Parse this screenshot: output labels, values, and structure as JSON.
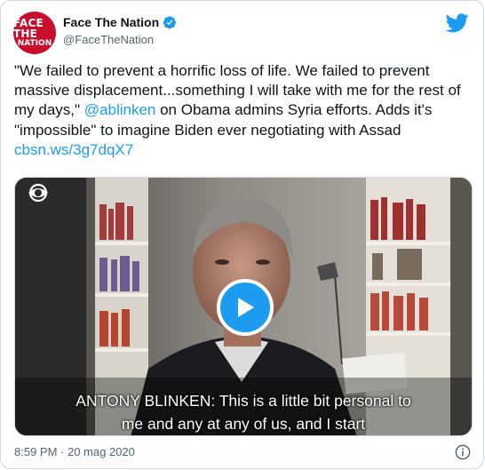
{
  "account": {
    "display_name": "Face The Nation",
    "handle": "@FaceTheNation",
    "avatar_line1": "FACE THE",
    "avatar_line2": "NATION",
    "verified": true
  },
  "tweet": {
    "part1": "\"We failed to prevent a horrific loss of life. We failed to prevent massive displacement...something I will take with me for the rest of my days,\" ",
    "mention": "@ablinken",
    "part2": " on Obama admins Syria efforts. Adds it's \"impossible\" to imagine Biden ever negotiating with Assad ",
    "link": "cbsn.ws/3g7dqX7"
  },
  "media": {
    "caption_line1": "ANTONY BLINKEN: This is a little bit personal to",
    "caption_line2": "me and any at any of us, and I start"
  },
  "footer": {
    "timestamp": "8:59 PM · 20 mag 2020"
  },
  "icons": {
    "brand": "twitter-bird-icon",
    "verified": "verified-badge-icon",
    "play": "play-icon",
    "info": "info-icon",
    "network": "cbs-eye-icon"
  },
  "colors": {
    "link": "#1d9bf0",
    "text": "#0f1419",
    "muted": "#536471",
    "avatar_red": "#c8102e"
  }
}
